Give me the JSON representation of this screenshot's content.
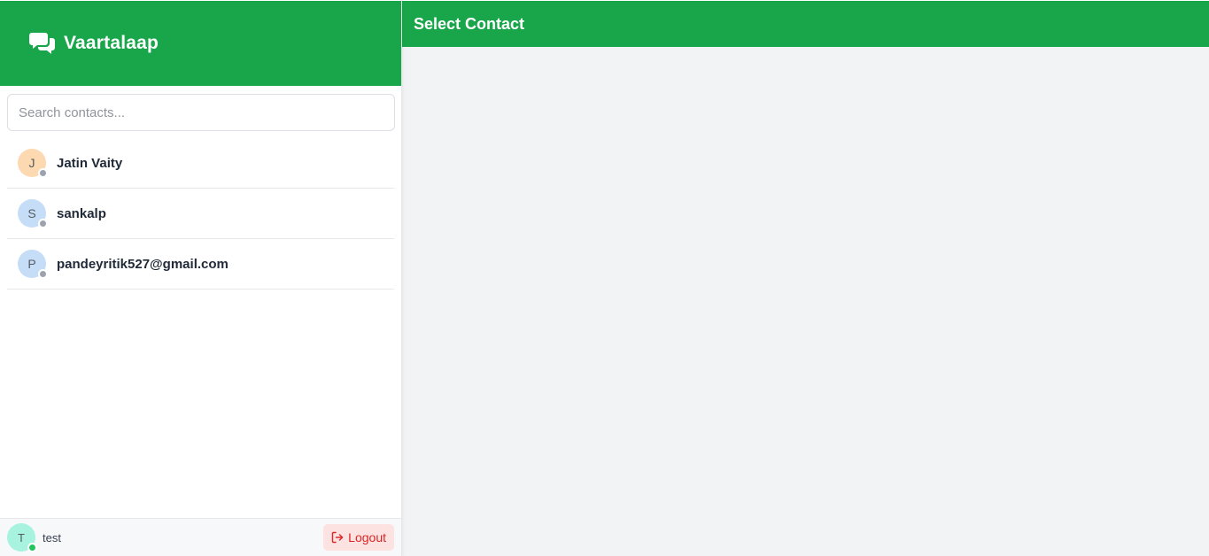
{
  "app": {
    "name": "Vaartalaap",
    "icon": "chat-bubbles-icon"
  },
  "search": {
    "placeholder": "Search contacts..."
  },
  "contacts": [
    {
      "initial": "J",
      "name": "Jatin Vaity",
      "avatar_color": "#fcd9b0",
      "status": "offline"
    },
    {
      "initial": "S",
      "name": "sankalp",
      "avatar_color": "#c6ddf7",
      "status": "offline"
    },
    {
      "initial": "P",
      "name": "pandeyritik527@gmail.com",
      "avatar_color": "#c6ddf7",
      "status": "offline"
    }
  ],
  "current_user": {
    "initial": "T",
    "name": "test",
    "avatar_color": "#a7f3e0",
    "status": "online"
  },
  "logout": {
    "label": "Logout",
    "icon": "logout-icon"
  },
  "main": {
    "title": "Select Contact"
  },
  "colors": {
    "brand": "#19a64b",
    "offline": "#9ca3af",
    "online": "#22c55e",
    "logout_text": "#dc2626",
    "logout_bg": "#fde2e2"
  }
}
